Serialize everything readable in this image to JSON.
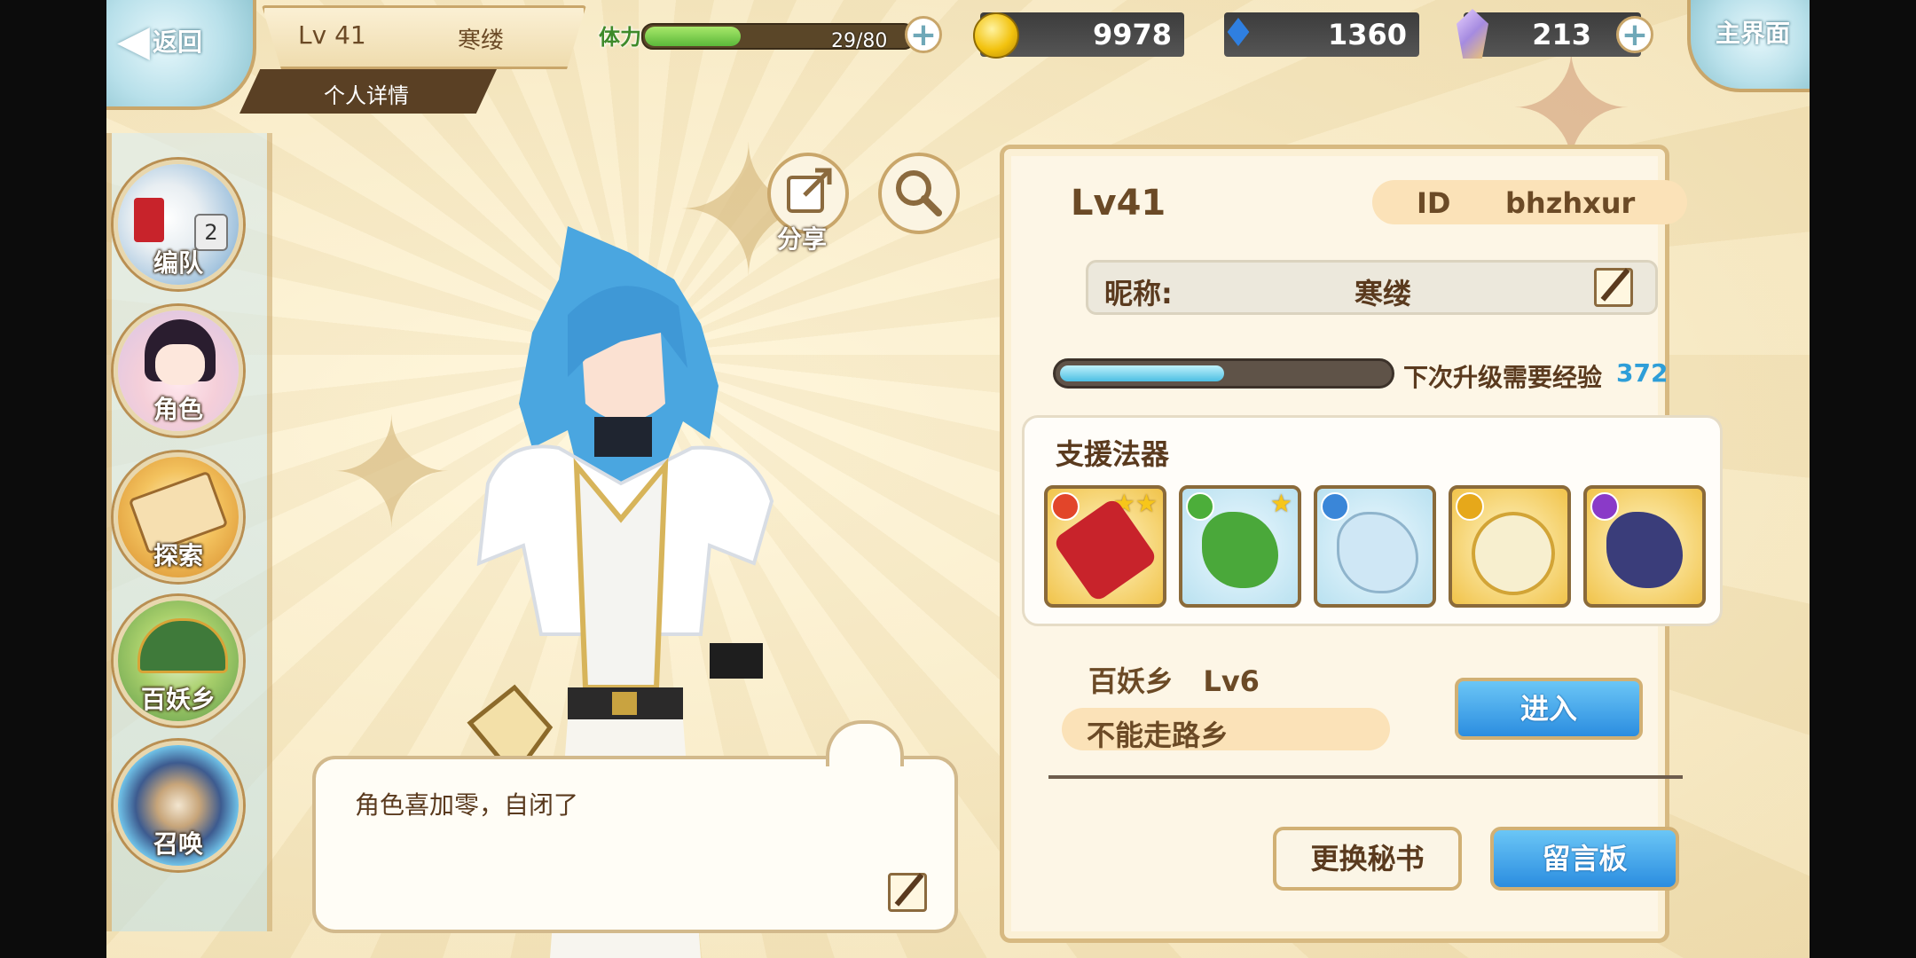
{
  "topbar": {
    "back_label": "返回",
    "level_label": "Lv 41",
    "player_name": "寒缕",
    "subtab_label": "个人详情",
    "stamina_label": "体力",
    "stamina_text": "29/80",
    "stamina_fraction": 0.3625,
    "gold": "9978",
    "spirit": "1360",
    "crystal": "213",
    "main_label": "主界面"
  },
  "menu": {
    "items": [
      {
        "label": "编队",
        "badge": "2",
        "icon": "team-icon"
      },
      {
        "label": "角色",
        "icon": "character-icon"
      },
      {
        "label": "探索",
        "icon": "explore-icon"
      },
      {
        "label": "百妖乡",
        "icon": "village-icon"
      },
      {
        "label": "召唤",
        "icon": "summon-icon"
      }
    ]
  },
  "character": {
    "share_label": "分享",
    "speech_text": "角色喜加零，自闭了"
  },
  "profile": {
    "level": "Lv41",
    "id_key": "ID",
    "id_value": "bhzhxur",
    "nickname_key": "昵称:",
    "nickname_value": "寒缕",
    "exp_label": "下次升级需要经验",
    "exp_value": "372",
    "exp_fraction": 0.5,
    "support_title": "支援法器",
    "support_items": [
      {
        "icon": "red-scroll-icon",
        "element_color": "#e2452a",
        "stars": "★★"
      },
      {
        "icon": "green-plant-icon",
        "element_color": "#4cae3a",
        "stars": "★"
      },
      {
        "icon": "ice-dragon-icon",
        "element_color": "#3a86d8",
        "stars": ""
      },
      {
        "icon": "golden-compass-icon",
        "element_color": "#e6a81a",
        "stars": ""
      },
      {
        "icon": "dark-sword-icon",
        "element_color": "#8a3ac8",
        "stars": ""
      }
    ],
    "village_line": "百妖乡   Lv6",
    "village_name": "不能走路乡",
    "enter_label": "进入",
    "secretary_label": "更换秘书",
    "message_label": "留言板"
  }
}
